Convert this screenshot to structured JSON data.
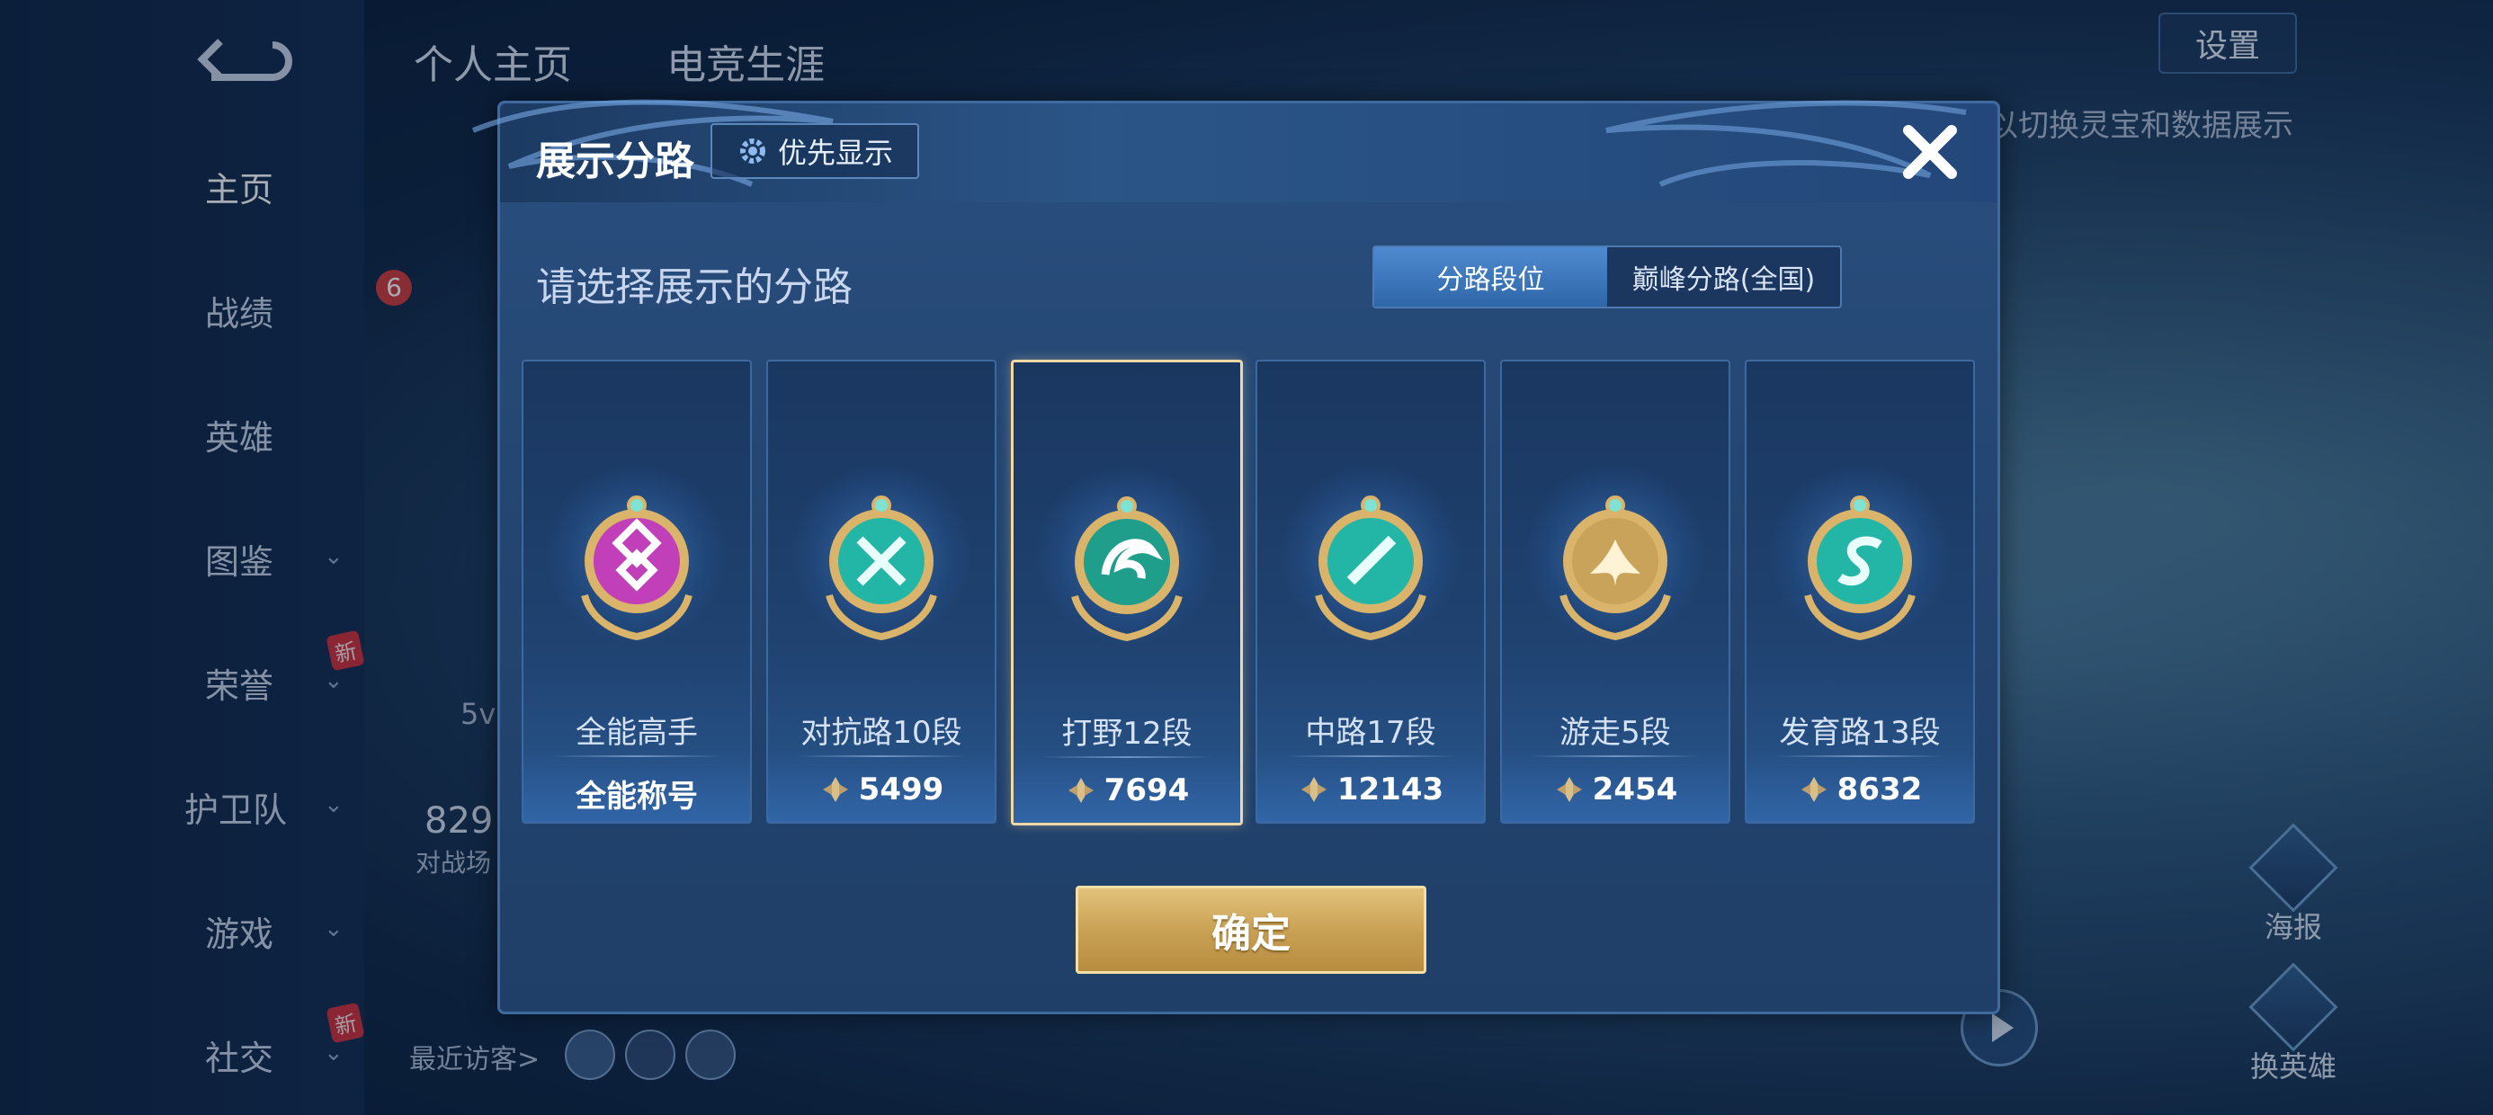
{
  "background": {
    "sidebar": {
      "items": [
        {
          "label": "主页",
          "chevron": false,
          "new": false
        },
        {
          "label": "战绩",
          "chevron": false,
          "new": false
        },
        {
          "label": "英雄",
          "chevron": false,
          "new": false
        },
        {
          "label": "图鉴",
          "chevron": true,
          "new": false
        },
        {
          "label": "荣誉",
          "chevron": true,
          "new": true
        },
        {
          "label": "护卫队",
          "chevron": true,
          "new": false
        },
        {
          "label": "游戏",
          "chevron": true,
          "new": false
        },
        {
          "label": "社交",
          "chevron": true,
          "new": true
        }
      ],
      "new_tag": "新"
    },
    "tabs": [
      "个人主页",
      "电竞生涯"
    ],
    "settings_label": "设置",
    "hint_text": "以切换灵宝和数据展示",
    "left_fragments": {
      "mode": "5v",
      "number": "829",
      "label": "对战场",
      "level": "6"
    },
    "recent_visitors_label": "最近访客>",
    "right_buttons": [
      "海报",
      "换英雄"
    ]
  },
  "modal": {
    "title": "展示分路",
    "priority_button": "优先显示",
    "subtitle": "请选择展示的分路",
    "toggle": {
      "options": [
        "分路段位",
        "巅峰分路(全国)"
      ],
      "selected": "分路段位"
    },
    "cards": [
      {
        "name": "全能高手",
        "score": "全能称号",
        "show_icon": false,
        "selected": false,
        "badge_color": "#c13fb8",
        "emblem": "allround"
      },
      {
        "name": "对抗路10段",
        "score": "5499",
        "show_icon": true,
        "selected": false,
        "badge_color": "#23b6a6",
        "emblem": "clash"
      },
      {
        "name": "打野12段",
        "score": "7694",
        "show_icon": true,
        "selected": true,
        "badge_color": "#1f9e8c",
        "emblem": "jungle"
      },
      {
        "name": "中路17段",
        "score": "12143",
        "show_icon": true,
        "selected": false,
        "badge_color": "#23b6a6",
        "emblem": "mid"
      },
      {
        "name": "游走5段",
        "score": "2454",
        "show_icon": true,
        "selected": false,
        "badge_color": "#c9a35a",
        "emblem": "roam"
      },
      {
        "name": "发育路13段",
        "score": "8632",
        "show_icon": true,
        "selected": false,
        "badge_color": "#23b6a6",
        "emblem": "farm"
      }
    ],
    "confirm_button": "确定"
  }
}
